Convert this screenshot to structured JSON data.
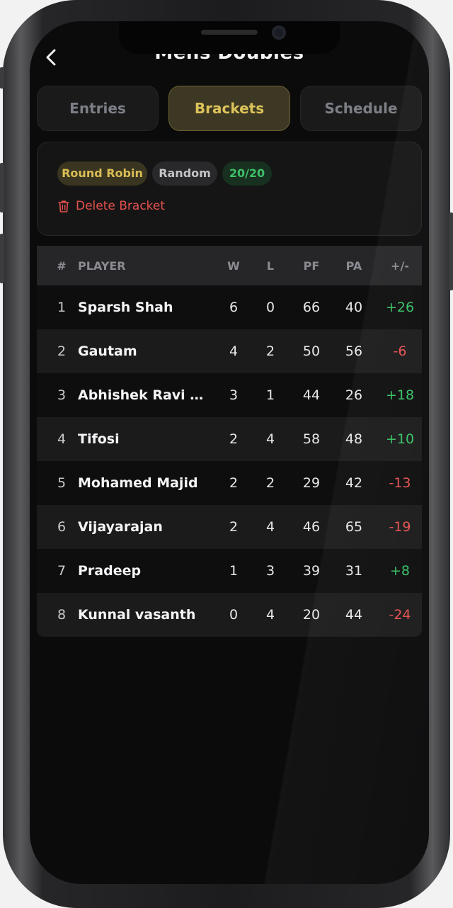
{
  "header": {
    "title": "Mens Doubles"
  },
  "tabs": [
    {
      "label": "Entries",
      "active": false
    },
    {
      "label": "Brackets",
      "active": true
    },
    {
      "label": "Schedule",
      "active": false
    }
  ],
  "bracket": {
    "format": "Round Robin",
    "seeding": "Random",
    "count": "20/20",
    "delete_label": "Delete Bracket"
  },
  "standings": {
    "columns": {
      "rank": "#",
      "player": "PLAYER",
      "w": "W",
      "l": "L",
      "pf": "PF",
      "pa": "PA",
      "diff": "+/-"
    },
    "rows": [
      {
        "rank": "1",
        "player": "Sparsh Shah",
        "w": "6",
        "l": "0",
        "pf": "66",
        "pa": "40",
        "diff": "+26"
      },
      {
        "rank": "2",
        "player": "Gautam",
        "w": "4",
        "l": "2",
        "pf": "50",
        "pa": "56",
        "diff": "-6"
      },
      {
        "rank": "3",
        "player": "Abhishek Ravi S...",
        "w": "3",
        "l": "1",
        "pf": "44",
        "pa": "26",
        "diff": "+18"
      },
      {
        "rank": "4",
        "player": "Tifosi",
        "w": "2",
        "l": "4",
        "pf": "58",
        "pa": "48",
        "diff": "+10"
      },
      {
        "rank": "5",
        "player": "Mohamed Majid",
        "w": "2",
        "l": "2",
        "pf": "29",
        "pa": "42",
        "diff": "-13"
      },
      {
        "rank": "6",
        "player": "Vijayarajan",
        "w": "2",
        "l": "4",
        "pf": "46",
        "pa": "65",
        "diff": "-19"
      },
      {
        "rank": "7",
        "player": "Pradeep",
        "w": "1",
        "l": "3",
        "pf": "39",
        "pa": "31",
        "diff": "+8"
      },
      {
        "rank": "8",
        "player": "Kunnal vasanth",
        "w": "0",
        "l": "4",
        "pf": "20",
        "pa": "44",
        "diff": "-24"
      }
    ]
  },
  "colors": {
    "accent_gold": "#dcc25a",
    "positive": "#37c164",
    "negative": "#e4514e",
    "background": "#0b0b0c"
  },
  "icons": {
    "back": "chevron-left-icon",
    "delete": "trash-icon"
  }
}
